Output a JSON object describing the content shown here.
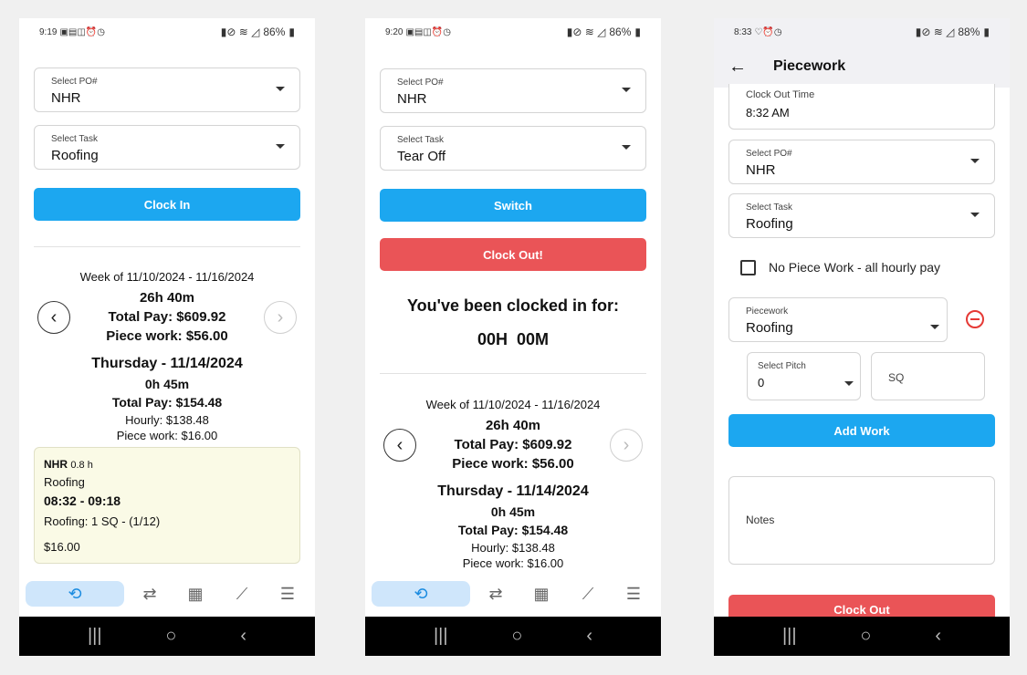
{
  "phone1": {
    "time": "9:19",
    "battery": "86%",
    "po": {
      "label": "Select PO#",
      "value": "NHR"
    },
    "task": {
      "label": "Select Task",
      "value": "Roofing"
    },
    "clock_in_label": "Clock In",
    "week": "Week of 11/10/2024 - 11/16/2024",
    "week_hours": "26h 40m",
    "week_total": "Total Pay: $609.92",
    "week_piece": "Piece work: $56.00",
    "day_title": "Thursday - 11/14/2024",
    "day_hours": "0h 45m",
    "day_total": "Total Pay: $154.48",
    "day_hourly": "Hourly: $138.48",
    "day_piece": "Piece work: $16.00",
    "entry": {
      "po": "NHR",
      "hours": "0.8 h",
      "task": "Roofing",
      "range": "08:32 - 09:18",
      "work": "Roofing:  1 SQ - (1/12)",
      "amount": "$16.00"
    }
  },
  "phone2": {
    "time": "9:20",
    "battery": "86%",
    "po": {
      "label": "Select PO#",
      "value": "NHR"
    },
    "task": {
      "label": "Select Task",
      "value": "Tear Off"
    },
    "switch_label": "Switch",
    "clock_out_label": "Clock Out!",
    "clocked_msg": "You've been clocked in for:",
    "clocked_time": "00H  00M",
    "week": "Week of 11/10/2024 - 11/16/2024",
    "week_hours": "26h 40m",
    "week_total": "Total Pay: $609.92",
    "week_piece": "Piece work: $56.00",
    "day_title": "Thursday - 11/14/2024",
    "day_hours": "0h 45m",
    "day_total": "Total Pay: $154.48",
    "day_hourly": "Hourly: $138.48",
    "day_piece": "Piece work: $16.00"
  },
  "phone3": {
    "time": "8:33",
    "battery": "88%",
    "title": "Piecework",
    "clock_out_time_label": "Clock Out Time",
    "clock_out_time_value": "8:32 AM",
    "po": {
      "label": "Select PO#",
      "value": "NHR"
    },
    "task": {
      "label": "Select Task",
      "value": "Roofing"
    },
    "no_piece_label": "No Piece Work - all hourly pay",
    "piecework": {
      "label": "Piecework",
      "value": "Roofing"
    },
    "pitch": {
      "label": "Select Pitch",
      "value": "0"
    },
    "sq_placeholder": "SQ",
    "add_work_label": "Add Work",
    "notes_placeholder": "Notes",
    "clock_out_label": "Clock Out"
  }
}
